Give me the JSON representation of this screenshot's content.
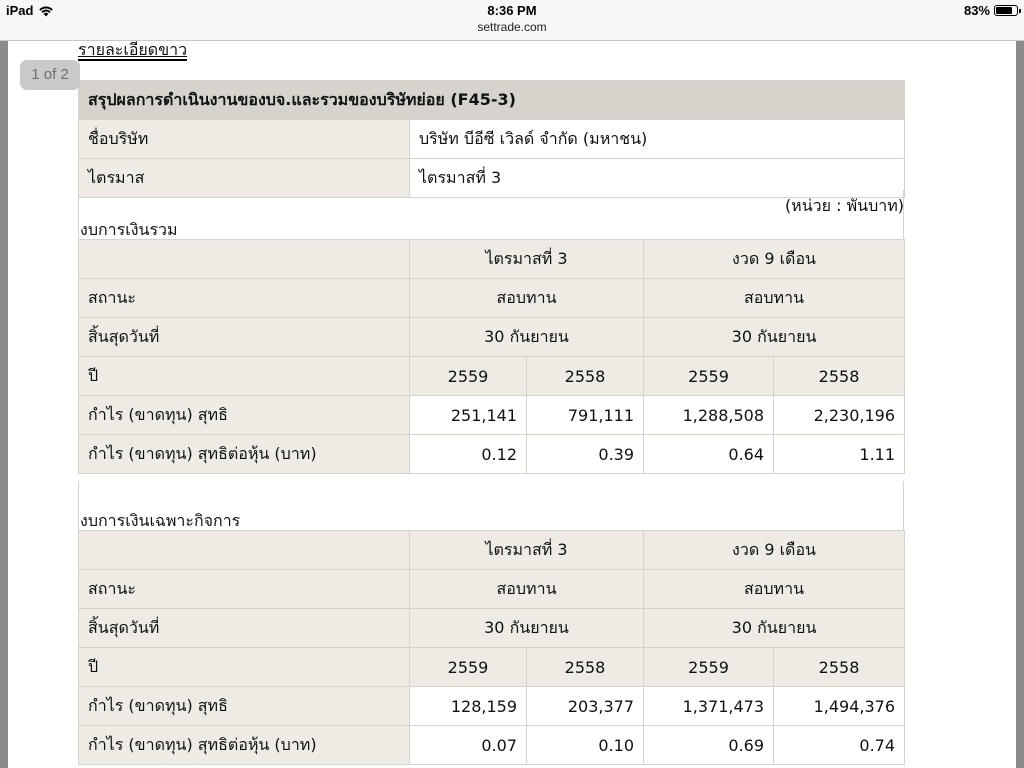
{
  "status_bar": {
    "device": "iPad",
    "time": "8:36 PM",
    "url": "settrade.com",
    "battery": "83%",
    "battery_level": 0.83
  },
  "page_indicator": "1 of 2",
  "doc_link": "รายละเอียดขาว",
  "report": {
    "title": "สรุปผลการดำเนินงานของบจ.และรวมของบริษัทย่อย (F45-3)",
    "company_label": "ชื่อบริษัท",
    "company_value": "บริษัท บีอีซี เวิลด์ จำกัด (มหาชน)",
    "quarter_label": "ไตรมาส",
    "quarter_value": "ไตรมาสที่ 3",
    "unit": "(หน่วย : พันบาท)"
  },
  "consolidated": {
    "section_title": "งบการเงินรวม",
    "col_q3": "ไตรมาสที่ 3",
    "col_9m": "งวด 9 เดือน",
    "status_label": "สถานะ",
    "status_q3": "สอบทาน",
    "status_9m": "สอบทาน",
    "enddate_label": "สิ้นสุดวันที่",
    "enddate_q3": "30 กันยายน",
    "enddate_9m": "30 กันยายน",
    "year_label": "ปี",
    "years": [
      "2559",
      "2558",
      "2559",
      "2558"
    ],
    "profit_label": "กำไร (ขาดทุน) สุทธิ",
    "profit": [
      "251,141",
      "791,111",
      "1,288,508",
      "2,230,196"
    ],
    "eps_label": "กำไร (ขาดทุน) สุทธิต่อหุ้น (บาท)",
    "eps": [
      "0.12",
      "0.39",
      "0.64",
      "1.11"
    ]
  },
  "separate": {
    "section_title": "งบการเงินเฉพาะกิจการ",
    "col_q3": "ไตรมาสที่ 3",
    "col_9m": "งวด 9 เดือน",
    "status_label": "สถานะ",
    "status_q3": "สอบทาน",
    "status_9m": "สอบทาน",
    "enddate_label": "สิ้นสุดวันที่",
    "enddate_q3": "30 กันยายน",
    "enddate_9m": "30 กันยายน",
    "year_label": "ปี",
    "years": [
      "2559",
      "2558",
      "2559",
      "2558"
    ],
    "profit_label": "กำไร (ขาดทุน) สุทธิ",
    "profit": [
      "128,159",
      "203,377",
      "1,371,473",
      "1,494,376"
    ],
    "eps_label": "กำไร (ขาดทุน) สุทธิต่อหุ้น (บาท)",
    "eps": [
      "0.07",
      "0.10",
      "0.69",
      "0.74"
    ]
  }
}
